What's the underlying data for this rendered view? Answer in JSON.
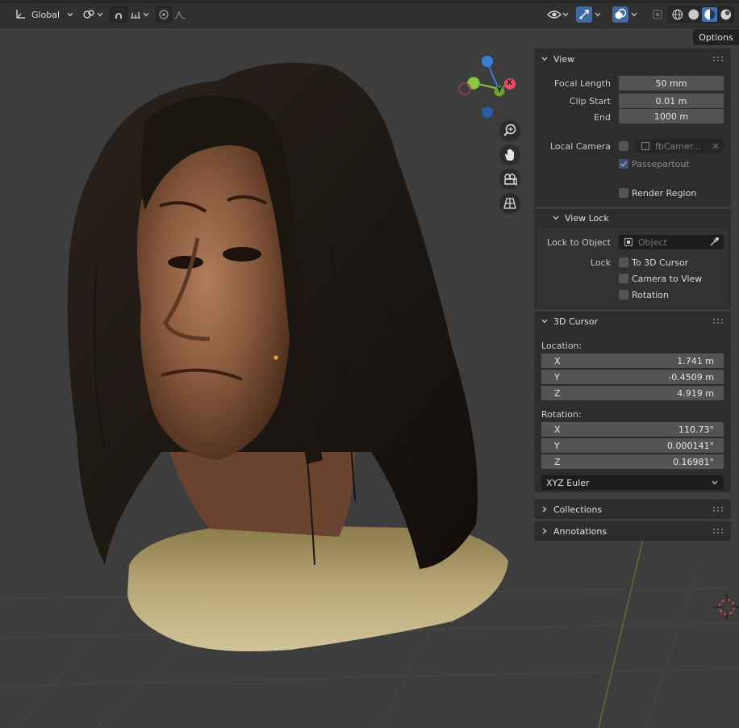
{
  "header": {
    "orientation_label": "Global",
    "transform_icon": "transform-orientation-icon",
    "pivot_icon": "pivot-icon",
    "snap_icon": "snap-magnet-icon",
    "snap_increment_icon": "snap-increment-icon",
    "proportional_icon": "proportional-edit-icon",
    "falloff_icon": "falloff-curve-icon",
    "visibility_icon": "eye-icon",
    "gizmo_icon": "gizmo-icon",
    "overlay_icon": "overlay-icon",
    "xray_icon": "xray-icon",
    "shading_icons": [
      "wireframe-icon",
      "solid-icon",
      "material-icon",
      "rendered-icon"
    ]
  },
  "options_label": "Options",
  "gizmo": {
    "x": "X",
    "y": "Y"
  },
  "view_panel": {
    "title": "View",
    "focal_length_label": "Focal Length",
    "focal_length_value": "50 mm",
    "clip_start_label": "Clip Start",
    "clip_start_value": "0.01 m",
    "end_label": "End",
    "end_value": "1000 m",
    "local_camera_label": "Local Camera",
    "local_camera_value": "fbCamer...",
    "passepartout_label": "Passepartout",
    "render_region_label": "Render Region"
  },
  "view_lock": {
    "title": "View Lock",
    "lock_to_object_label": "Lock to Object",
    "object_placeholder": "Object",
    "lock_label": "Lock",
    "to_3d_cursor": "To 3D Cursor",
    "camera_to_view": "Camera to View",
    "rotation": "Rotation"
  },
  "cursor_panel": {
    "title": "3D Cursor",
    "location_label": "Location:",
    "location": [
      {
        "axis": "X",
        "value": "1.741 m"
      },
      {
        "axis": "Y",
        "value": "-0.4509 m"
      },
      {
        "axis": "Z",
        "value": "4.919 m"
      }
    ],
    "rotation_label": "Rotation:",
    "rotation": [
      {
        "axis": "X",
        "value": "110.73°"
      },
      {
        "axis": "Y",
        "value": "0.000141°"
      },
      {
        "axis": "Z",
        "value": "0.16981°"
      }
    ],
    "rotation_mode": "XYZ Euler"
  },
  "collections_title": "Collections",
  "annotations_title": "Annotations",
  "colors": {
    "accent": "#4772b3",
    "x_axis": "#e84a5f",
    "y_axis": "#8ac73e",
    "z_axis": "#3d7cd6"
  }
}
